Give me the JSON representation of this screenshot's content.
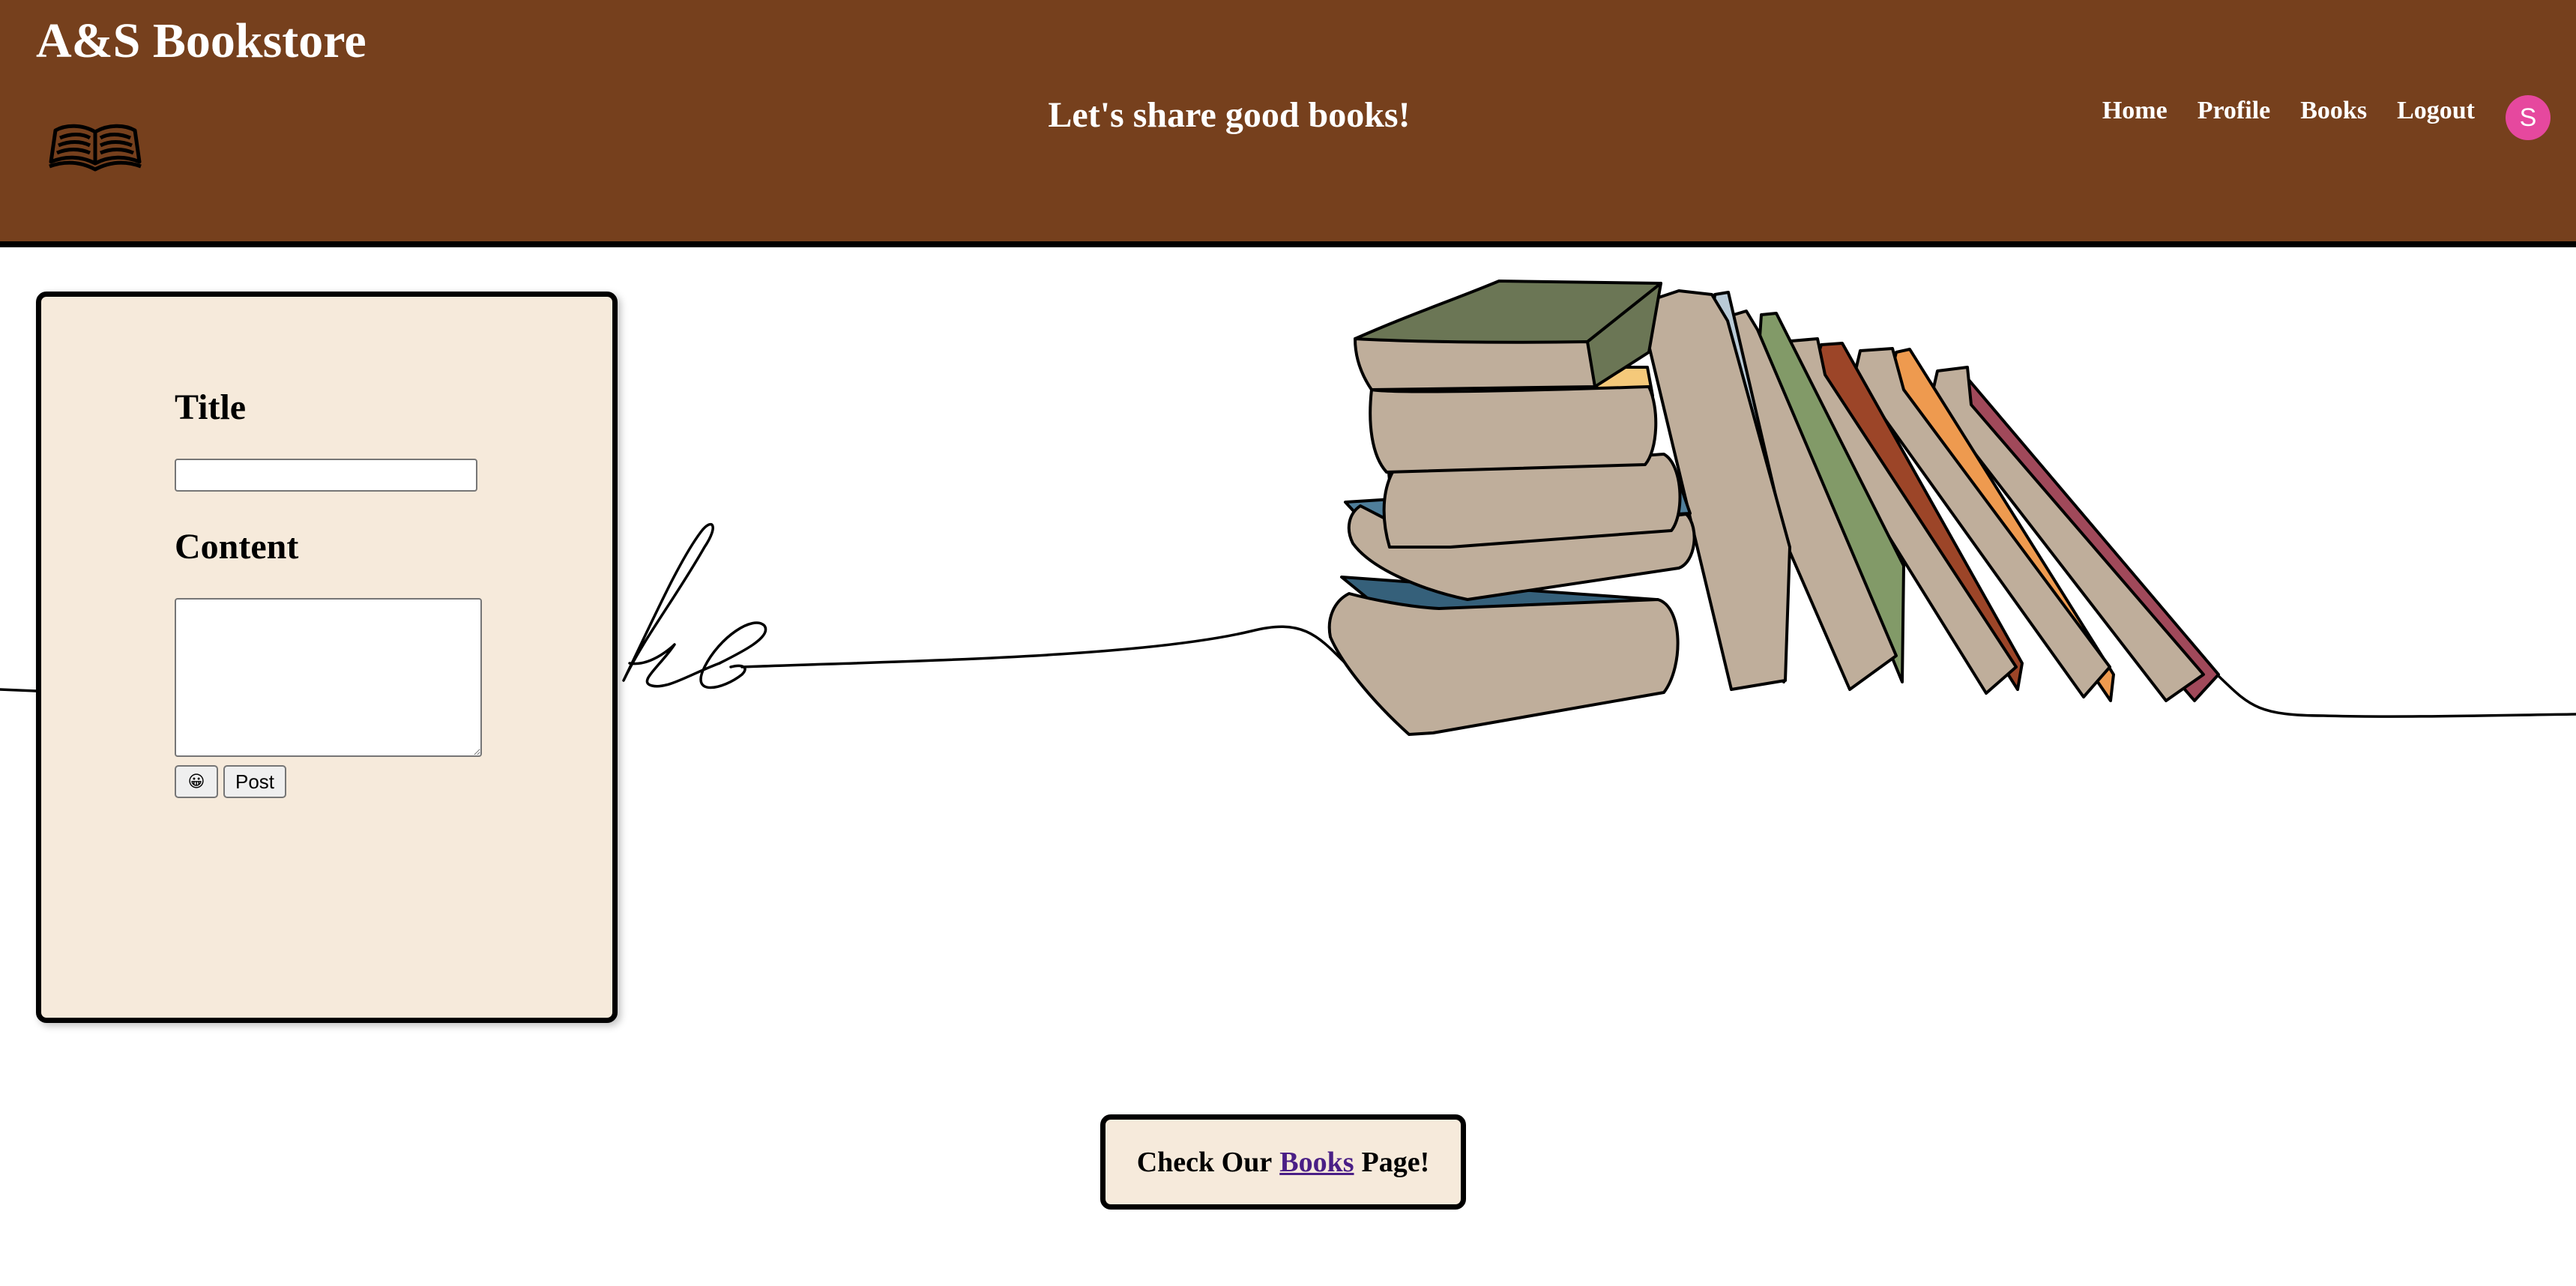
{
  "header": {
    "store_name": "A&S Bookstore",
    "tagline": "Let's share good books!",
    "logo_icon": "open-book-icon",
    "background_color": "#76401d"
  },
  "nav": {
    "items": [
      {
        "label": "Home"
      },
      {
        "label": "Profile"
      },
      {
        "label": "Books"
      },
      {
        "label": "Logout"
      }
    ],
    "avatar_letter": "S",
    "avatar_color": "#e6489e"
  },
  "post_form": {
    "title_label": "Title",
    "title_value": "",
    "content_label": "Content",
    "content_value": "",
    "emoji_button": "😀",
    "post_button": "Post",
    "panel_color": "#f6eadb"
  },
  "cta": {
    "prefix": "Check Our",
    "link": "Books",
    "suffix": "Page!"
  },
  "illustration": {
    "name": "stack-of-books-illustration",
    "colors": [
      "#6b7655",
      "#bfae9b",
      "#4f7e9a",
      "#35607a",
      "#e06b4f",
      "#b9cad6",
      "#829a68",
      "#9c4528",
      "#ee9a4f",
      "#a0495a"
    ]
  }
}
